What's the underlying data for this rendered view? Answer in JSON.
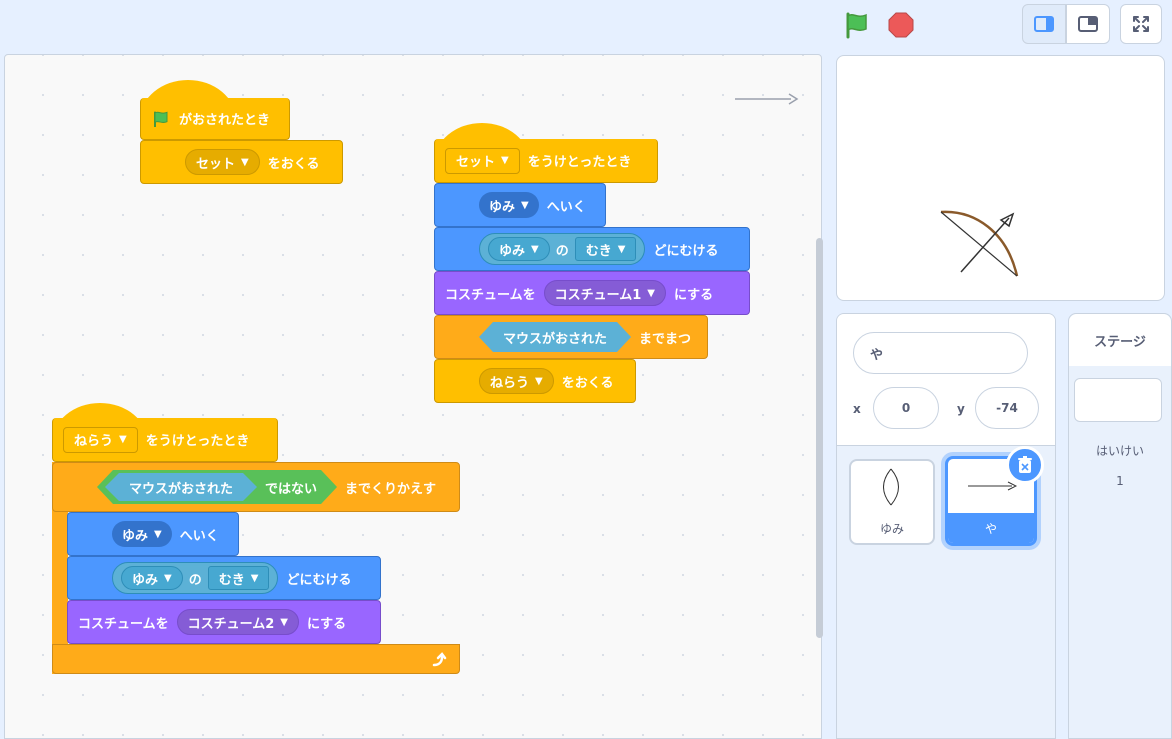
{
  "toolbar": {
    "green_flag": "green-flag-icon",
    "stop": "stop-icon",
    "small_stage": "small-stage-icon",
    "large_stage": "large-stage-icon",
    "fullscreen": "fullscreen-icon"
  },
  "scripts": {
    "script1": {
      "hat_label": "がおされたとき",
      "broadcast_value": "セット",
      "broadcast_label": "をおくる"
    },
    "script2": {
      "hat_value": "セット",
      "hat_label": "をうけとったとき",
      "goto_value": "ゆみ",
      "goto_label": "へいく",
      "point_sprite": "ゆみ",
      "point_of": "の",
      "point_prop": "むき",
      "point_label": "どにむける",
      "costume_prefix": "コスチュームを",
      "costume_value": "コスチューム1",
      "costume_suffix": "にする",
      "wait_condition": "マウスがおされた",
      "wait_label": "までまつ",
      "broadcast_value": "ねらう",
      "broadcast_label": "をおくる"
    },
    "script3": {
      "hat_value": "ねらう",
      "hat_label": "をうけとったとき",
      "loop_condition": "マウスがおされた",
      "not_label": "ではない",
      "loop_label": "までくりかえす",
      "goto_value": "ゆみ",
      "goto_label": "へいく",
      "point_sprite": "ゆみ",
      "point_of": "の",
      "point_prop": "むき",
      "point_label": "どにむける",
      "costume_prefix": "コスチュームを",
      "costume_value": "コスチューム2",
      "costume_suffix": "にする"
    }
  },
  "sprite_info": {
    "name": "や",
    "x_label": "x",
    "x_value": "0",
    "y_label": "y",
    "y_value": "-74"
  },
  "sprites": [
    {
      "name": "ゆみ",
      "selected": false
    },
    {
      "name": "や",
      "selected": true
    }
  ],
  "stage_panel": {
    "title": "ステージ",
    "backdrop_label": "はいけい",
    "backdrop_count": "1"
  },
  "colors": {
    "events": "#ffbf00",
    "control": "#ffab19",
    "motion": "#4c97ff",
    "looks": "#9966ff",
    "sensing": "#5cb1d6",
    "operators": "#59c059"
  }
}
